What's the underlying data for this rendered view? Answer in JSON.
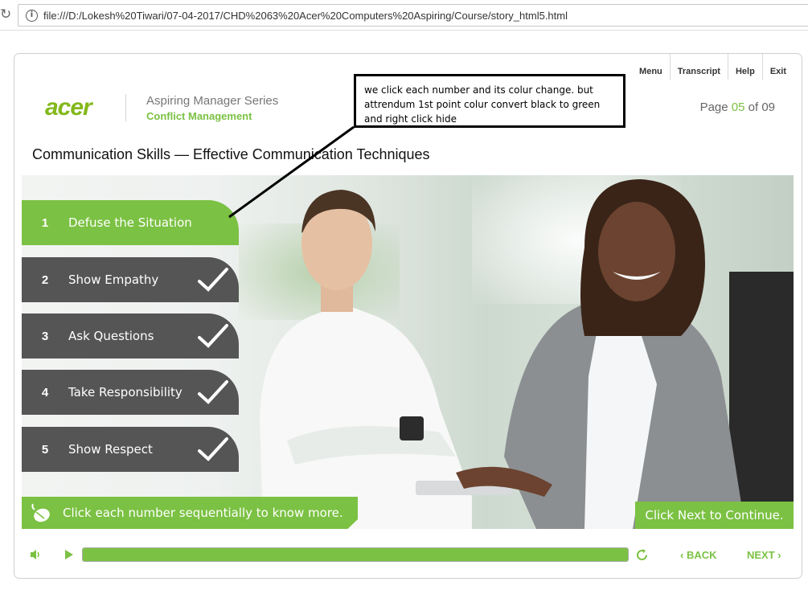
{
  "browser": {
    "url": "file:///D:/Lokesh%20Tiwari/07-04-2017/CHD%2063%20Acer%20Computers%20Aspiring/Course/story_html5.html"
  },
  "topnav": [
    "Menu",
    "Transcript",
    "Help",
    "Exit"
  ],
  "brand": {
    "logo": "acer",
    "series": "Aspiring Manager Series",
    "subtitle": "Conflict Management"
  },
  "page": {
    "prefix": "Page ",
    "current": "05",
    "middle": " of ",
    "total": "09"
  },
  "heading": "Communication Skills — Effective Communication Techniques",
  "menu": [
    {
      "num": "1",
      "label": "Defuse the Situation",
      "active": true,
      "checked": false
    },
    {
      "num": "2",
      "label": "Show Empathy",
      "active": false,
      "checked": true
    },
    {
      "num": "3",
      "label": "Ask Questions",
      "active": false,
      "checked": true
    },
    {
      "num": "4",
      "label": "Take Responsibility",
      "active": false,
      "checked": true
    },
    {
      "num": "5",
      "label": "Show Respect",
      "active": false,
      "checked": true
    }
  ],
  "instruction": "Click each number sequentially to know more.",
  "next_hint": "Click Next to Continue.",
  "controls": {
    "back": "BACK",
    "next": "NEXT",
    "progress": 1.0
  },
  "callout": "we click each number and its colur change. but attrendum 1st point colur convert black to green and right click hide",
  "colors": {
    "accent": "#7bc143",
    "dark_item": "#555555"
  }
}
